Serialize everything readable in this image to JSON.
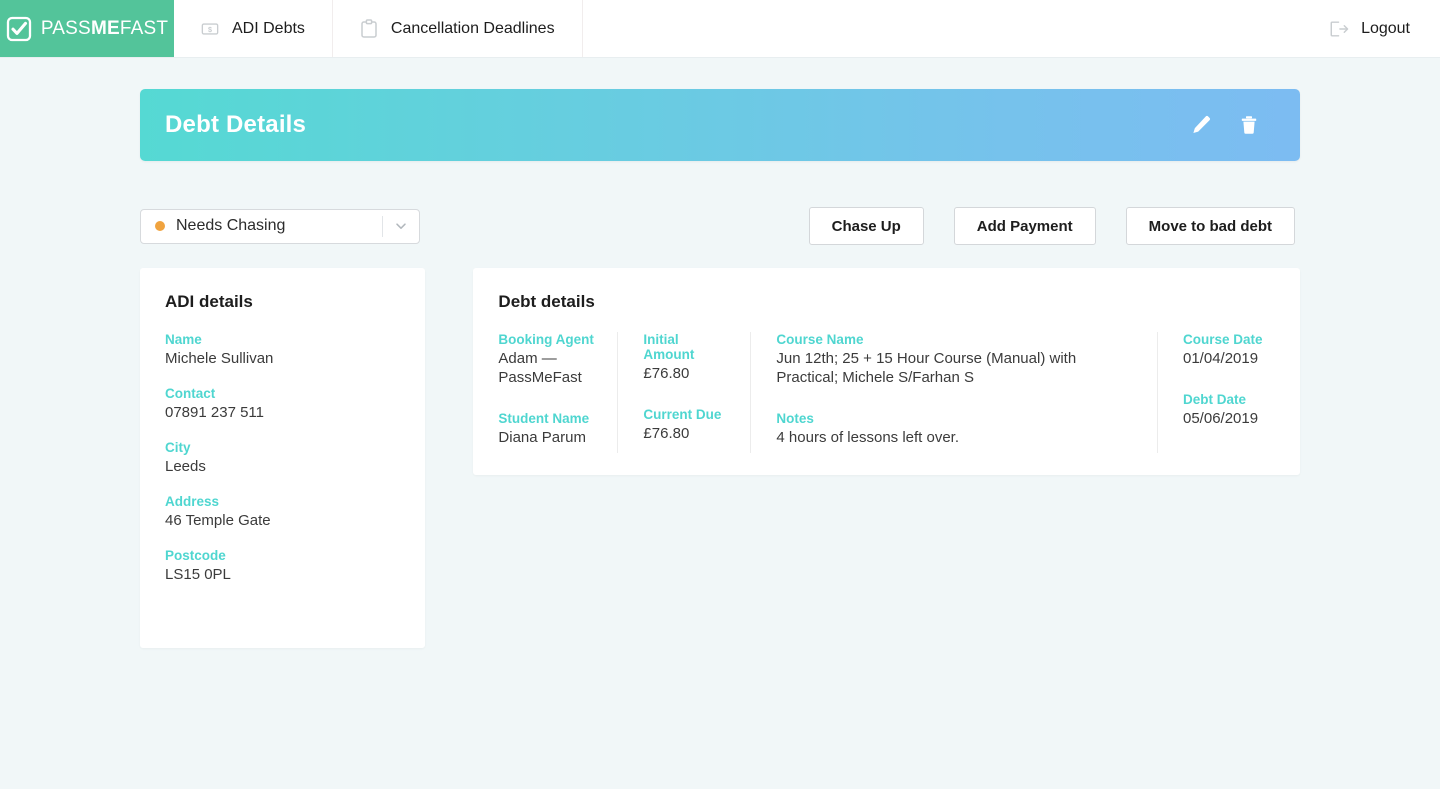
{
  "nav": {
    "logo": {
      "icon": "checkbox-check-icon",
      "text_light_1": "PASS",
      "text_bold": "ME",
      "text_light_2": "FAST"
    },
    "tabs": [
      {
        "label": "ADI Debts",
        "icon": "banknote-icon"
      },
      {
        "label": "Cancellation Deadlines",
        "icon": "clipboard-icon"
      }
    ],
    "logout": {
      "label": "Logout",
      "icon": "sign-out-icon"
    }
  },
  "banner": {
    "title": "Debt Details",
    "edit_icon": "pencil-icon",
    "delete_icon": "trash-icon",
    "gradient_from": "#55d9d3",
    "gradient_to": "#7cbcf2"
  },
  "controls": {
    "status": {
      "value": "Needs Chasing",
      "dot_color": "#f0a33f",
      "chevron_icon": "chevron-down-icon"
    },
    "buttons": [
      {
        "label": "Chase Up"
      },
      {
        "label": "Add Payment"
      },
      {
        "label": "Move to bad debt"
      }
    ]
  },
  "adi_card": {
    "title": "ADI details",
    "fields": [
      {
        "label": "Name",
        "value": "Michele Sullivan"
      },
      {
        "label": "Contact",
        "value": "07891 237 511"
      },
      {
        "label": "City",
        "value": "Leeds"
      },
      {
        "label": "Address",
        "value": "46 Temple Gate"
      },
      {
        "label": "Postcode",
        "value": "LS15 0PL"
      }
    ]
  },
  "debt_card": {
    "title": "Debt details",
    "columns": [
      {
        "fields": [
          {
            "label": "Booking Agent",
            "value": "Adam — PassMeFast"
          },
          {
            "label": "Student Name",
            "value": "Diana Parum"
          }
        ]
      },
      {
        "fields": [
          {
            "label": "Initial Amount",
            "value": "£76.80"
          },
          {
            "label": "Current Due",
            "value": "£76.80"
          }
        ]
      },
      {
        "fields": [
          {
            "label": "Course Name",
            "value": "Jun 12th; 25 + 15 Hour Course (Manual) with Practical; Michele S/Farhan S"
          },
          {
            "label": "Notes",
            "value": "4 hours of lessons left over."
          }
        ]
      },
      {
        "fields": [
          {
            "label": "Course Date",
            "value": "01/04/2019"
          },
          {
            "label": "Debt Date",
            "value": "05/06/2019"
          }
        ]
      }
    ]
  },
  "theme": {
    "label_color": "#4fd6d0",
    "brand_green": "#53c49a",
    "page_bg": "#f1f7f8"
  }
}
